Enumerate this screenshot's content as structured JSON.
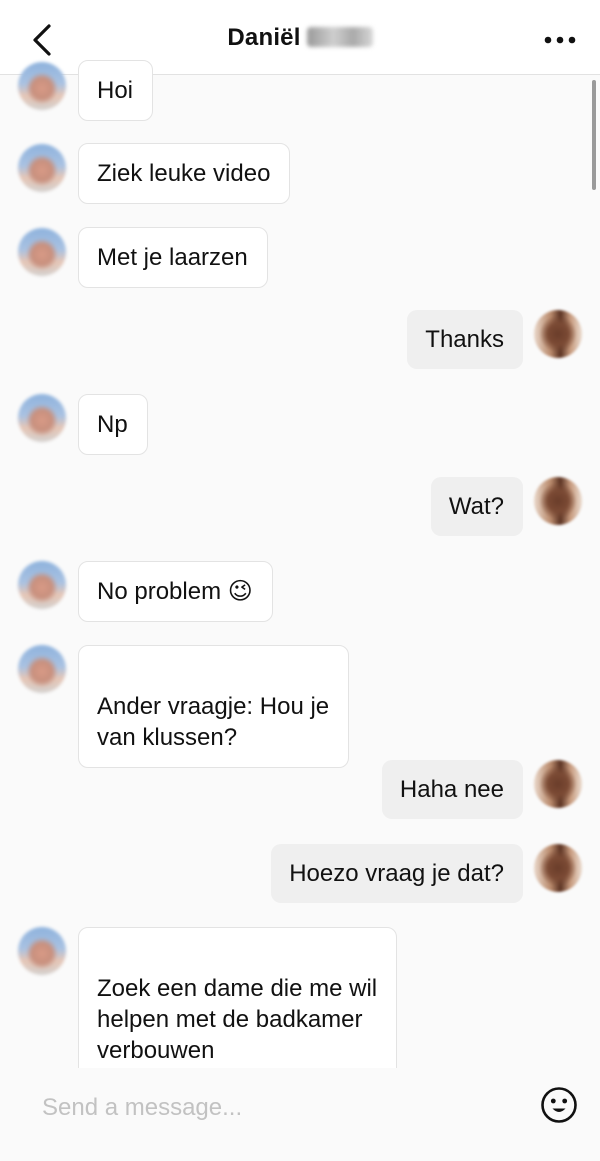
{
  "header": {
    "contact_name": "Daniël"
  },
  "messages": [
    {
      "direction": "in",
      "text": "Hoi"
    },
    {
      "direction": "in",
      "text": "Ziek leuke video"
    },
    {
      "direction": "in",
      "text": "Met je laarzen"
    },
    {
      "direction": "out",
      "text": "Thanks"
    },
    {
      "direction": "in",
      "text": "Np"
    },
    {
      "direction": "out",
      "text": "Wat?"
    },
    {
      "direction": "in",
      "text": "No problem 😉"
    },
    {
      "direction": "in",
      "text": "Ander vraagje: Hou je\nvan klussen?"
    },
    {
      "direction": "out",
      "text": "Haha nee"
    },
    {
      "direction": "out",
      "text": "Hoezo vraag je dat?"
    },
    {
      "direction": "in",
      "text": "Zoek een dame die me wil\nhelpen met de badkamer\nverbouwen"
    }
  ],
  "composer": {
    "placeholder": "Send a message..."
  },
  "icons": {
    "back": "chevron-left-icon",
    "more": "more-horizontal-icon",
    "emoji": "smiley-icon"
  }
}
